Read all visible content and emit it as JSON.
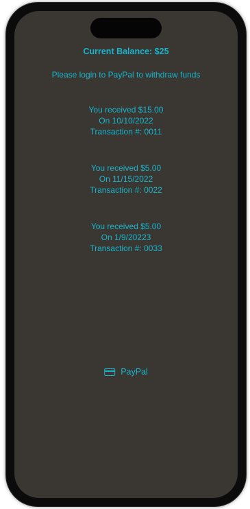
{
  "balance": {
    "text": "Current Balance: $25"
  },
  "login_message": "Please login to PayPal to withdraw funds",
  "transactions": [
    {
      "received": "You received $15.00",
      "date": "On 10/10/2022",
      "number": "Transaction #: 0011"
    },
    {
      "received": "You received $5.00",
      "date": "On 11/15/2022",
      "number": "Transaction #: 0022"
    },
    {
      "received": "You received $5.00",
      "date": "On 1/9/20223",
      "number": "Transaction #: 0033"
    }
  ],
  "paypal_button": {
    "label": "PayPal",
    "icon": "credit-card-icon"
  },
  "colors": {
    "accent": "#18b5cc",
    "screen_background": "#3a3632"
  }
}
